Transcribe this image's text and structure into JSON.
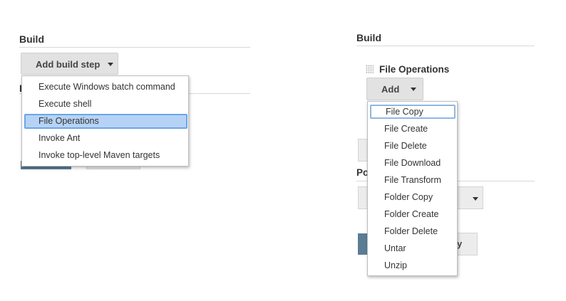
{
  "left": {
    "section_title": "Build",
    "add_build_step_label": "Add build step",
    "dropdown_items": [
      {
        "label": "Execute Windows batch command",
        "highlighted": false
      },
      {
        "label": "Execute shell",
        "highlighted": false
      },
      {
        "label": "File Operations",
        "highlighted": true
      },
      {
        "label": "Invoke Ant",
        "highlighted": false
      },
      {
        "label": "Invoke top-level Maven targets",
        "highlighted": false
      }
    ],
    "occluded_heading_fragment": "B"
  },
  "right": {
    "section_title": "Build",
    "step_title": "File Operations",
    "add_label": "Add",
    "dropdown_items": [
      {
        "label": "File Copy",
        "focused": true
      },
      {
        "label": "File Create",
        "focused": false
      },
      {
        "label": "File Delete",
        "focused": false
      },
      {
        "label": "File Download",
        "focused": false
      },
      {
        "label": "File Transform",
        "focused": false
      },
      {
        "label": "Folder Copy",
        "focused": false
      },
      {
        "label": "Folder Create",
        "focused": false
      },
      {
        "label": "Folder Delete",
        "focused": false
      },
      {
        "label": "Untar",
        "focused": false
      },
      {
        "label": "Unzip",
        "focused": false
      }
    ],
    "occluded_heading_fragment": "Po",
    "occluded_button_fragment": "y"
  },
  "colors": {
    "highlight_bg": "#b6d3f5",
    "highlight_border": "#6aa6e8",
    "button_bg": "#e2e2e2",
    "primary_button": "#5b7c95"
  },
  "icons": {
    "dropdown_caret": "caret-down-icon",
    "drag_handle": "drag-grip-icon"
  }
}
